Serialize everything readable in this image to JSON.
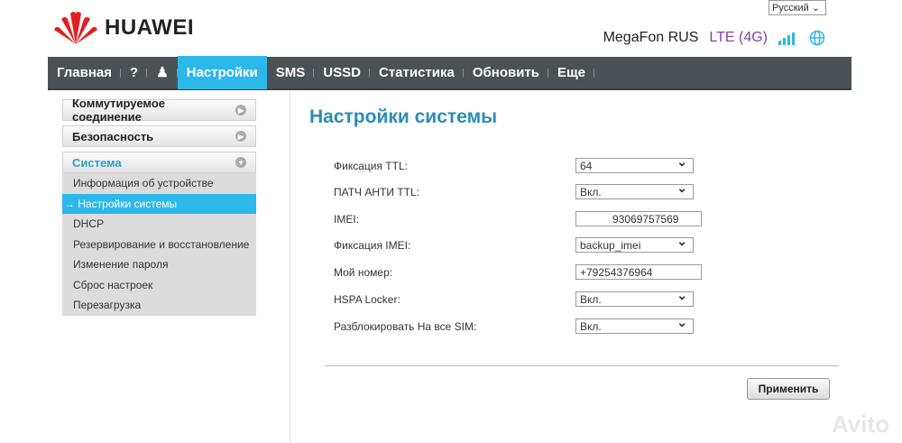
{
  "header": {
    "language": "Русский",
    "brand": "HUAWEI",
    "operator": "MegaFon RUS",
    "network": "LTE (4G)"
  },
  "nav": [
    {
      "label": "Главная"
    },
    {
      "label": "?"
    },
    {
      "label": "♟"
    },
    {
      "label": "Настройки"
    },
    {
      "label": "SMS"
    },
    {
      "label": "USSD"
    },
    {
      "label": "Статистика"
    },
    {
      "label": "Обновить"
    },
    {
      "label": "Еще"
    }
  ],
  "sidebar": {
    "sections": [
      "Коммутируемое соединение",
      "Безопасность",
      "Система"
    ],
    "items": [
      "Информация об устройстве",
      "→ Настройки системы",
      "DHCP",
      "Резервирование и восстановление",
      "Изменение пароля",
      "Сброс настроек",
      "Перезагрузка"
    ]
  },
  "main": {
    "title": "Настройки системы",
    "fields": [
      {
        "label": "Фиксация TTL:",
        "value": "64"
      },
      {
        "label": "ПАТЧ АНТИ TTL:",
        "value": "Вкл."
      },
      {
        "label": "IMEI:",
        "value": "93069757569"
      },
      {
        "label": "Фиксация IMEI:",
        "value": "backup_imei"
      },
      {
        "label": "Мой номер:",
        "value": "+79254376964"
      },
      {
        "label": "HSPA Locker:",
        "value": "Вкл."
      },
      {
        "label": "Разблокировать На все SIM:",
        "value": "Вкл."
      }
    ],
    "apply": "Применить"
  },
  "watermark": "Avito",
  "colors": {
    "accent": "#2db8ea",
    "nav": "#4b5256",
    "title": "#2a8db4",
    "brand": "#e02020"
  }
}
